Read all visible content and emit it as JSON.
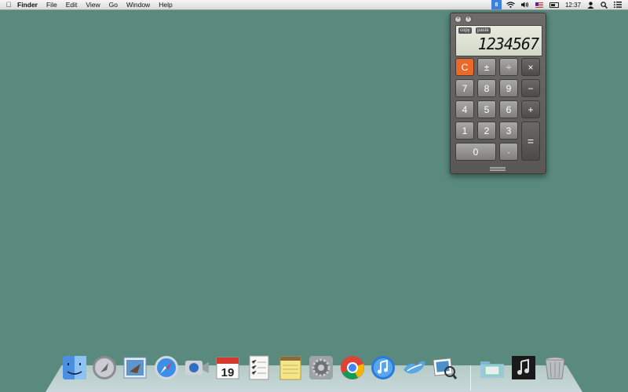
{
  "menubar": {
    "apple_icon": "apple-logo-icon",
    "app_name": "Finder",
    "menus": [
      "File",
      "Edit",
      "View",
      "Go",
      "Window",
      "Help"
    ],
    "status": {
      "clock": "12:37",
      "icons": [
        "dashboard-widget-icon",
        "wifi-icon",
        "volume-icon",
        "us-flag-input-icon",
        "battery-icon",
        "user-icon",
        "spotlight-icon",
        "notification-list-icon"
      ]
    }
  },
  "calculator": {
    "copy_label": "copy",
    "paste_label": "paste",
    "display_value": "1234567",
    "keys": {
      "clear": "C",
      "plus_minus": "±",
      "divide": "÷",
      "multiply": "×",
      "seven": "7",
      "eight": "8",
      "nine": "9",
      "minus": "−",
      "four": "4",
      "five": "5",
      "six": "6",
      "plus": "+",
      "one": "1",
      "two": "2",
      "three": "3",
      "equals": "=",
      "zero": "0",
      "decimal": "·"
    },
    "accent_color": "#e8692a"
  },
  "dock": {
    "items": [
      {
        "name": "finder-icon"
      },
      {
        "name": "launchpad-icon"
      },
      {
        "name": "mail-icon"
      },
      {
        "name": "safari-icon"
      },
      {
        "name": "facetime-icon"
      },
      {
        "name": "calendar-icon",
        "day": "19"
      },
      {
        "name": "reminders-icon"
      },
      {
        "name": "notes-icon"
      },
      {
        "name": "system-preferences-icon"
      },
      {
        "name": "chrome-icon"
      },
      {
        "name": "itunes-icon"
      },
      {
        "name": "openoffice-icon"
      },
      {
        "name": "preview-icon"
      },
      {
        "name": "downloads-folder-icon"
      },
      {
        "name": "music-folder-icon"
      },
      {
        "name": "trash-icon"
      }
    ]
  }
}
